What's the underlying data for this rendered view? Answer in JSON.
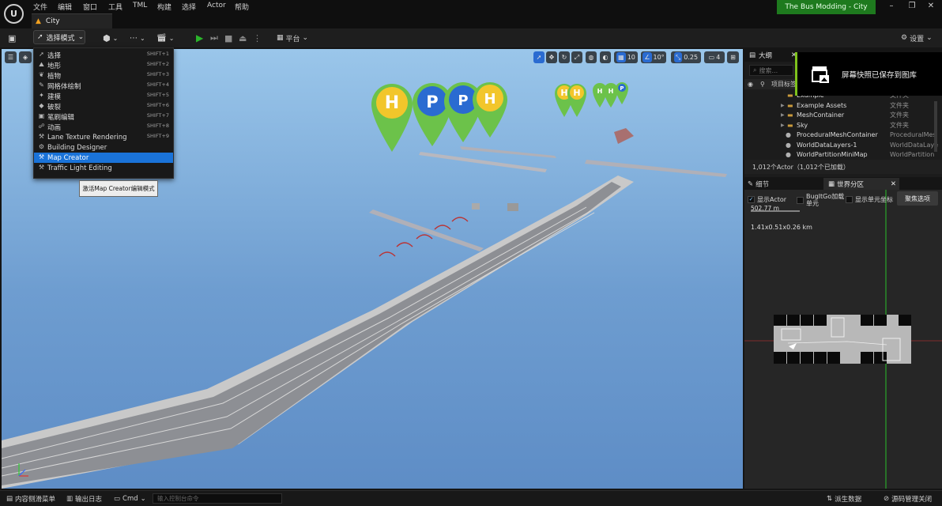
{
  "menubar": {
    "items": [
      "文件",
      "编辑",
      "窗口",
      "工具",
      "TML",
      "构建",
      "选择",
      "Actor",
      "帮助"
    ],
    "logo": "U",
    "level_tab": "City",
    "project_name": "The Bus Modding - City"
  },
  "toolbar": {
    "mode_button": "选择模式",
    "platform_button": "平台",
    "settings_button": "设置"
  },
  "mode_menu": {
    "items": [
      {
        "label": "选择",
        "shortcut": "SHIFT+1",
        "icon": "select-arrow-icon"
      },
      {
        "label": "地形",
        "shortcut": "SHIFT+2",
        "icon": "landscape-icon"
      },
      {
        "label": "植物",
        "shortcut": "SHIFT+3",
        "icon": "foliage-icon"
      },
      {
        "label": "网格体绘制",
        "shortcut": "SHIFT+4",
        "icon": "mesh-paint-icon"
      },
      {
        "label": "建模",
        "shortcut": "SHIFT+5",
        "icon": "modeling-icon"
      },
      {
        "label": "破裂",
        "shortcut": "SHIFT+6",
        "icon": "fracture-icon"
      },
      {
        "label": "笔刷编辑",
        "shortcut": "SHIFT+7",
        "icon": "brush-edit-icon"
      },
      {
        "label": "动画",
        "shortcut": "SHIFT+8",
        "icon": "animation-icon"
      },
      {
        "label": "Lane Texture Rendering",
        "shortcut": "SHIFT+9",
        "icon": "lane-texture-icon"
      },
      {
        "label": "Building Designer",
        "shortcut": "",
        "icon": "building-icon"
      },
      {
        "label": "Map Creator",
        "shortcut": "",
        "icon": "map-creator-icon"
      },
      {
        "label": "Traffic Light Editing",
        "shortcut": "",
        "icon": "traffic-light-icon"
      }
    ],
    "selected_index": 10,
    "tooltip": "激活Map Creator编辑模式"
  },
  "viewport": {
    "grid_size": "10",
    "rotation_snap": "10°",
    "scale_snap": "0.25",
    "camera_speed": "4"
  },
  "outliner": {
    "title": "大纲",
    "search_placeholder": "搜索...",
    "column_label": "项目标签",
    "rows": [
      {
        "name": "Example",
        "type": "文件夹",
        "kind": "folder"
      },
      {
        "name": "Example Assets",
        "type": "文件夹",
        "kind": "folder"
      },
      {
        "name": "MeshContainer",
        "type": "文件夹",
        "kind": "folder"
      },
      {
        "name": "Sky",
        "type": "文件夹",
        "kind": "folder"
      },
      {
        "name": "ProceduralMeshContainer",
        "type": "ProceduralMes",
        "kind": "actor"
      },
      {
        "name": "WorldDataLayers-1",
        "type": "WorldDataLaye",
        "kind": "actor"
      },
      {
        "name": "WorldPartitionMiniMap",
        "type": "WorldPartition",
        "kind": "actor"
      }
    ],
    "actor_count": "1,012个Actor（1,012个已加载）"
  },
  "toast": {
    "message": "屏幕快照已保存到图库"
  },
  "details": {
    "tab_details": "细节",
    "tab_world_partition": "世界分区",
    "show_actor": "显示Actor",
    "bugitgo": "BugItGo加载单元",
    "show_cell_coords": "显示单元坐标",
    "focus_selection": "聚焦选项",
    "scale_label": "502.77 m",
    "world_size": "1.41x0.51x0.26 km"
  },
  "bottombar": {
    "content_drawer": "内容侧滑菜单",
    "output_log": "输出日志",
    "cmd": "Cmd",
    "console_placeholder": "输入控制台命令",
    "derived_data": "派生数据",
    "source_control": "源码管理关闭"
  },
  "colors": {
    "accent": "#1a73d9",
    "play_green": "#2bb52b",
    "project_badge": "#1e7a1e",
    "toast_accent": "#7ec11c",
    "sky_top": "#9ac6ea",
    "sky_bottom": "#5e8dc6",
    "marker_green": "#6cc24a",
    "marker_blue": "#2a6bd1",
    "marker_yellow": "#f2c62b"
  }
}
